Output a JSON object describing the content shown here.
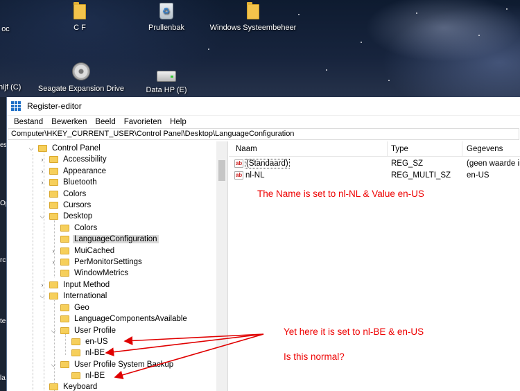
{
  "desktop": {
    "icons": [
      {
        "label": "oc"
      },
      {
        "label": "C F"
      },
      {
        "label": "Prullenbak"
      },
      {
        "label": "Windows Systeembeheer"
      },
      {
        "label": "hijf (C)"
      },
      {
        "label": "Seagate Expansion Drive"
      },
      {
        "label": "Data HP (E)"
      }
    ],
    "left_strip": [
      "es",
      "Op",
      "rc",
      "te",
      "la"
    ]
  },
  "window": {
    "title": "Register-editor",
    "menu": [
      "Bestand",
      "Bewerken",
      "Beeld",
      "Favorieten",
      "Help"
    ],
    "address": "Computer\\HKEY_CURRENT_USER\\Control Panel\\Desktop\\LanguageConfiguration"
  },
  "tree": [
    {
      "label": "Control Panel",
      "expander": "down"
    },
    {
      "label": "Accessibility",
      "expander": "right"
    },
    {
      "label": "Appearance",
      "expander": "right"
    },
    {
      "label": "Bluetooth",
      "expander": "right"
    },
    {
      "label": "Colors",
      "expander": ""
    },
    {
      "label": "Cursors",
      "expander": ""
    },
    {
      "label": "Desktop",
      "expander": "down"
    },
    {
      "label": "Colors",
      "expander": ""
    },
    {
      "label": "LanguageConfiguration",
      "expander": "",
      "selected": true
    },
    {
      "label": "MuiCached",
      "expander": "right"
    },
    {
      "label": "PerMonitorSettings",
      "expander": "right"
    },
    {
      "label": "WindowMetrics",
      "expander": ""
    },
    {
      "label": "Input Method",
      "expander": "right"
    },
    {
      "label": "International",
      "expander": "down"
    },
    {
      "label": "Geo",
      "expander": ""
    },
    {
      "label": "LanguageComponentsAvailable",
      "expander": ""
    },
    {
      "label": "User Profile",
      "expander": "down"
    },
    {
      "label": "en-US",
      "expander": ""
    },
    {
      "label": "nl-BE",
      "expander": ""
    },
    {
      "label": "User Profile System Backup",
      "expander": "down"
    },
    {
      "label": "nl-BE",
      "expander": ""
    },
    {
      "label": "Keyboard",
      "expander": ""
    }
  ],
  "values_pane": {
    "columns": {
      "name": "Naam",
      "type": "Type",
      "data": "Gegevens"
    },
    "rows": [
      {
        "icon": "string-value-icon",
        "name": "(Standaard)",
        "type": "REG_SZ",
        "data": "(geen waarde ingesteld)"
      },
      {
        "icon": "string-value-icon",
        "name": "nl-NL",
        "type": "REG_MULTI_SZ",
        "data": "en-US"
      }
    ]
  },
  "annotations": {
    "note1": "The Name is set to nl-NL & Value en-US",
    "note2": "Yet here it is set to nl-BE & en-US",
    "note3": "Is this normal?",
    "color": "#e00000"
  }
}
